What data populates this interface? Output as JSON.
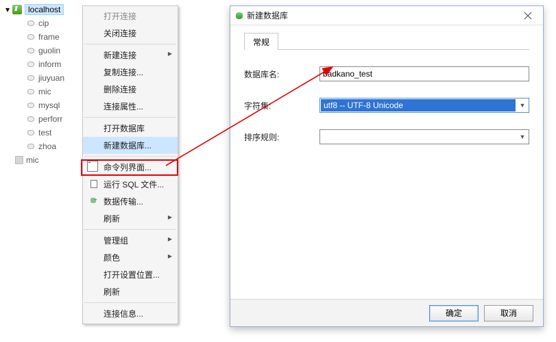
{
  "tree": {
    "root": "localhost",
    "items": [
      "cip",
      "frame",
      "guolin",
      "inform",
      "jiuyuan",
      "mic",
      "mysql",
      "perforr",
      "test",
      "zhoa"
    ],
    "sub": "mic"
  },
  "menu": {
    "header": "打开连接",
    "items": {
      "close_conn": "关闭连接",
      "new_conn": "新建连接",
      "dup_conn": "复制连接...",
      "del_conn": "删除连接",
      "conn_props": "连接属性...",
      "open_db": "打开数据库",
      "new_db": "新建数据库...",
      "cli": "命令列界面...",
      "run_sql": "运行 SQL 文件...",
      "data_xfer": "数据传输...",
      "refresh1": "刷新",
      "manage_group": "管理组",
      "color": "颜色",
      "open_settings": "打开设置位置...",
      "refresh2": "刷新",
      "conn_info": "连接信息..."
    }
  },
  "dialog": {
    "title": "新建数据库",
    "tab": "常规",
    "labels": {
      "db_name": "数据库名:",
      "charset": "字符集:",
      "collation": "排序规则:"
    },
    "values": {
      "db_name": "badkano_test",
      "charset": "utf8 -- UTF-8 Unicode",
      "collation": ""
    },
    "buttons": {
      "ok": "确定",
      "cancel": "取消"
    }
  }
}
